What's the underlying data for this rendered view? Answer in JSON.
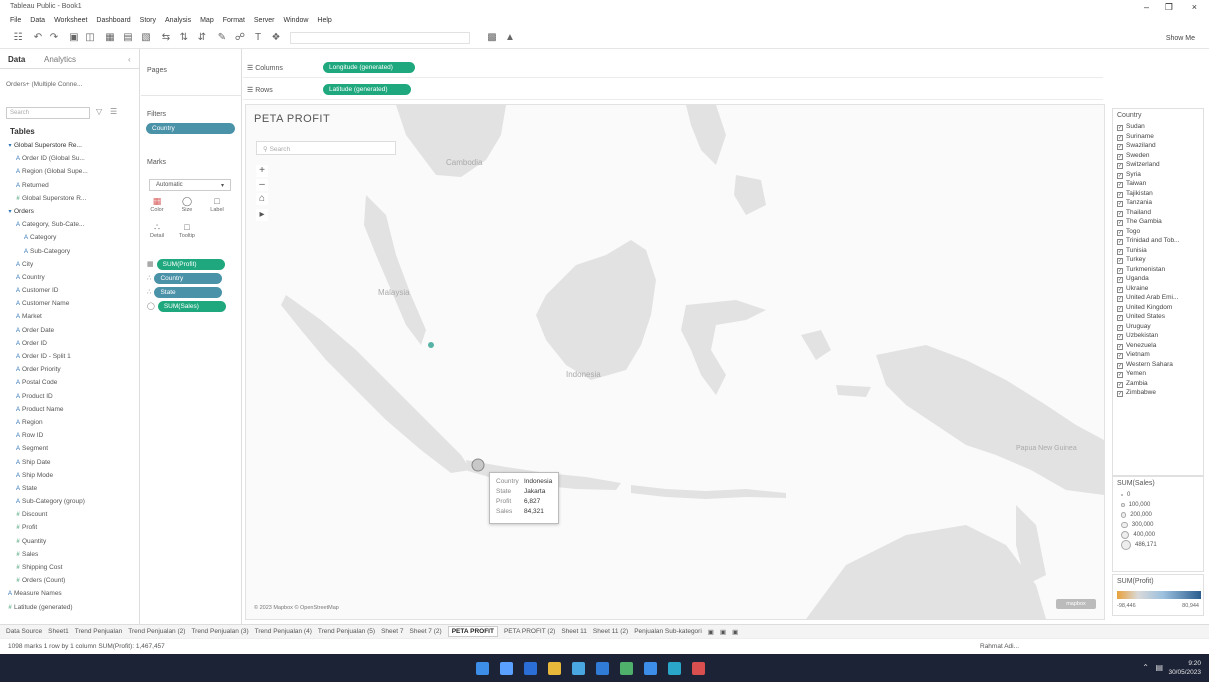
{
  "window": {
    "title": "Tableau Public - Book1"
  },
  "menu": [
    "File",
    "Data",
    "Worksheet",
    "Dashboard",
    "Story",
    "Analysis",
    "Map",
    "Format",
    "Server",
    "Window",
    "Help"
  ],
  "toolbar": {
    "show_me": "Show Me"
  },
  "data_pane": {
    "tab_data": "Data",
    "tab_analytics": "Analytics",
    "source": "Orders+ (Multiple Conne...",
    "search_placeholder": "Search",
    "tables_heading": "Tables",
    "fields": [
      {
        "label": "Global Superstore Re...",
        "kind": "table",
        "indent": 0
      },
      {
        "label": "Order ID (Global Su...",
        "kind": "dim",
        "indent": 1
      },
      {
        "label": "Region (Global Supe...",
        "kind": "dim",
        "indent": 1
      },
      {
        "label": "Returned",
        "kind": "dim",
        "indent": 1
      },
      {
        "label": "Global Superstore R...",
        "kind": "mea",
        "indent": 1
      },
      {
        "label": "Orders",
        "kind": "table",
        "indent": 0
      },
      {
        "label": "Category, Sub-Cate...",
        "kind": "dim",
        "indent": 1
      },
      {
        "label": "Category",
        "kind": "dim",
        "indent": 2
      },
      {
        "label": "Sub-Category",
        "kind": "dim",
        "indent": 2
      },
      {
        "label": "City",
        "kind": "dim",
        "indent": 1
      },
      {
        "label": "Country",
        "kind": "dim",
        "indent": 1
      },
      {
        "label": "Customer ID",
        "kind": "dim",
        "indent": 1
      },
      {
        "label": "Customer Name",
        "kind": "dim",
        "indent": 1
      },
      {
        "label": "Market",
        "kind": "dim",
        "indent": 1
      },
      {
        "label": "Order Date",
        "kind": "dim",
        "indent": 1
      },
      {
        "label": "Order ID",
        "kind": "dim",
        "indent": 1
      },
      {
        "label": "Order ID - Split 1",
        "kind": "dim",
        "indent": 1
      },
      {
        "label": "Order Priority",
        "kind": "dim",
        "indent": 1
      },
      {
        "label": "Postal Code",
        "kind": "dim",
        "indent": 1
      },
      {
        "label": "Product ID",
        "kind": "dim",
        "indent": 1
      },
      {
        "label": "Product Name",
        "kind": "dim",
        "indent": 1
      },
      {
        "label": "Region",
        "kind": "dim",
        "indent": 1
      },
      {
        "label": "Row ID",
        "kind": "dim",
        "indent": 1
      },
      {
        "label": "Segment",
        "kind": "dim",
        "indent": 1
      },
      {
        "label": "Ship Date",
        "kind": "dim",
        "indent": 1
      },
      {
        "label": "Ship Mode",
        "kind": "dim",
        "indent": 1
      },
      {
        "label": "State",
        "kind": "dim",
        "indent": 1
      },
      {
        "label": "Sub-Category (group)",
        "kind": "dim",
        "indent": 1
      },
      {
        "label": "Discount",
        "kind": "mea",
        "indent": 1
      },
      {
        "label": "Profit",
        "kind": "mea",
        "indent": 1
      },
      {
        "label": "Quantity",
        "kind": "mea",
        "indent": 1
      },
      {
        "label": "Sales",
        "kind": "mea",
        "indent": 1
      },
      {
        "label": "Shipping Cost",
        "kind": "mea",
        "indent": 1
      },
      {
        "label": "Orders (Count)",
        "kind": "mea",
        "indent": 1
      },
      {
        "label": "Measure Names",
        "kind": "dim",
        "indent": 0
      },
      {
        "label": "Latitude (generated)",
        "kind": "mea",
        "indent": 0
      }
    ]
  },
  "shelves": {
    "pages": "Pages",
    "filters": "Filters",
    "filter_pill": "Country",
    "marks": "Marks",
    "mark_type": "Automatic",
    "mark_buttons": [
      "Color",
      "Size",
      "Label",
      "Detail",
      "Tooltip"
    ],
    "mark_pills": [
      {
        "label": "SUM(Profit)",
        "color": "green"
      },
      {
        "label": "Country",
        "color": "blue"
      },
      {
        "label": "State",
        "color": "blue"
      },
      {
        "label": "SUM(Sales)",
        "color": "green"
      }
    ],
    "columns_label": "Columns",
    "columns_pill": "Longitude (generated)",
    "rows_label": "Rows",
    "rows_pill": "Latitude (generated)"
  },
  "view": {
    "title": "PETA PROFIT",
    "map_search_placeholder": "Search",
    "map_labels": [
      "Cambodia",
      "Malaysia",
      "Indonesia",
      "Papua New Guinea"
    ],
    "attribution": "© 2023 Mapbox © OpenStreetMap",
    "logo": "mapbox",
    "tooltip": [
      {
        "k": "Country",
        "v": "Indonesia"
      },
      {
        "k": "State",
        "v": "Jakarta"
      },
      {
        "k": "Profit",
        "v": "6,827"
      },
      {
        "k": "Sales",
        "v": "84,321"
      }
    ]
  },
  "legend": {
    "country_title": "Country",
    "countries": [
      "Sudan",
      "Suriname",
      "Swaziland",
      "Sweden",
      "Switzerland",
      "Syria",
      "Taiwan",
      "Tajikistan",
      "Tanzania",
      "Thailand",
      "The Gambia",
      "Togo",
      "Trinidad and Tob...",
      "Tunisia",
      "Turkey",
      "Turkmenistan",
      "Uganda",
      "Ukraine",
      "United Arab Emi...",
      "United Kingdom",
      "United States",
      "Uruguay",
      "Uzbekistan",
      "Venezuela",
      "Vietnam",
      "Western Sahara",
      "Yemen",
      "Zambia",
      "Zimbabwe"
    ],
    "size_title": "SUM(Sales)",
    "size_items": [
      "0",
      "100,000",
      "200,000",
      "300,000",
      "400,000",
      "486,171"
    ],
    "color_title": "SUM(Profit)",
    "color_min": "-98,446",
    "color_max": "80,944",
    "color_low": "#e8a13a",
    "color_high": "#2a5d8f"
  },
  "sheet_tabs": {
    "data_source": "Data Source",
    "tabs": [
      "Sheet1",
      "Trend Penjualan",
      "Trend Penjualan (2)",
      "Trend Penjualan (3)",
      "Trend Penjualan (4)",
      "Trend Penjualan (5)",
      "Sheet 7",
      "Sheet 7 (2)",
      "PETA PROFIT",
      "PETA PROFIT (2)",
      "Sheet 11",
      "Sheet 11 (2)",
      "Penjualan Sub-kategori"
    ],
    "active": "PETA PROFIT"
  },
  "status": {
    "left": "1098 marks    1 row by 1 column    SUM(Profit): 1,467,457",
    "user": "Rahmat Adi..."
  },
  "taskbar": {
    "time": "9:20",
    "date": "30/05/2023",
    "icon_colors": [
      "#3d8ee8",
      "#5aa0ff",
      "#2b6fd6",
      "#e8b83a",
      "#4aa6e0",
      "#2f7bd6",
      "#4fb06b",
      "#3d8ee8",
      "#29a6c9",
      "#d94f4f"
    ]
  }
}
